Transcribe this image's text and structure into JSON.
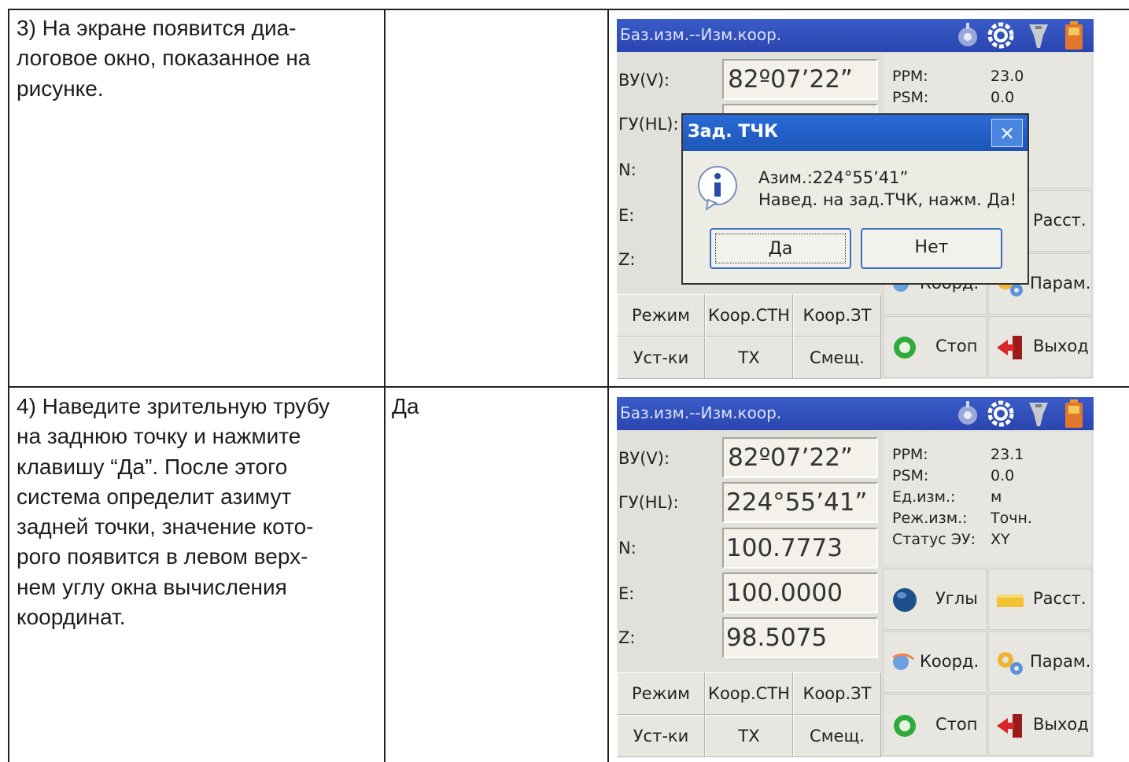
{
  "rows": [
    {
      "description": "3) На экране появится диа-\nлоговое окно, показанное на\nрисунке.",
      "key": "",
      "screen": {
        "title": "Баз.изм.--Изм.коор.",
        "fields": [
          {
            "label": "ВУ(V):",
            "value": "82º07’22”"
          },
          {
            "label": "ГУ(HL):",
            "value": ""
          },
          {
            "label": "N:",
            "value": ""
          },
          {
            "label": "E:",
            "value": ""
          },
          {
            "label": "Z:",
            "value": ""
          }
        ],
        "info": [
          {
            "key": "PPM:",
            "value": "23.0"
          },
          {
            "key": "PSM:",
            "value": "0.0"
          }
        ],
        "icon_buttons": {
          "dist": "Расст.",
          "coord": "Коорд.",
          "params": "Парам.",
          "stop": "Стоп",
          "exit": "Выход"
        },
        "softkeys": [
          "Режим",
          "Коор.СТН",
          "Коор.ЗТ",
          "Уст-ки",
          "ТХ",
          "Смещ."
        ],
        "dialog": {
          "title": "Зад. ТЧК",
          "close": "×",
          "line1": "Азим.:224°55’41”",
          "line2": "Навед. на зад.ТЧК, нажм. Да!",
          "yes": "Да",
          "no": "Нет"
        }
      }
    },
    {
      "description": "4) Наведите зрительную трубу\nна заднюю точку и нажмите\nклавишу “Да”. После этого\nсистема определит азимут\nзадней точки, значение кото-\nрого появится в левом верх-\nнем углу окна вычисления\nкоординат.",
      "key": "Да",
      "screen": {
        "title": "Баз.изм.--Изм.коор.",
        "fields": [
          {
            "label": "ВУ(V):",
            "value": "82º07’22”"
          },
          {
            "label": "ГУ(HL):",
            "value": "224°55’41”"
          },
          {
            "label": "N:",
            "value": "100.7773"
          },
          {
            "label": "E:",
            "value": "100.0000"
          },
          {
            "label": "Z:",
            "value": "98.5075"
          }
        ],
        "info": [
          {
            "key": "PPM:",
            "value": "23.1"
          },
          {
            "key": "PSM:",
            "value": "0.0"
          },
          {
            "key": "Ед.изм.:",
            "value": "м"
          },
          {
            "key": "Реж.изм.:",
            "value": "Точн."
          },
          {
            "key": "Статус ЭУ:",
            "value": "XY"
          }
        ],
        "icon_buttons": {
          "angles": "Углы",
          "dist": "Расст.",
          "coord": "Коорд.",
          "params": "Парам.",
          "stop": "Стоп",
          "exit": "Выход"
        },
        "softkeys": [
          "Режим",
          "Коор.СТН",
          "Коор.ЗТ",
          "Уст-ки",
          "ТХ",
          "Смещ."
        ]
      }
    }
  ]
}
